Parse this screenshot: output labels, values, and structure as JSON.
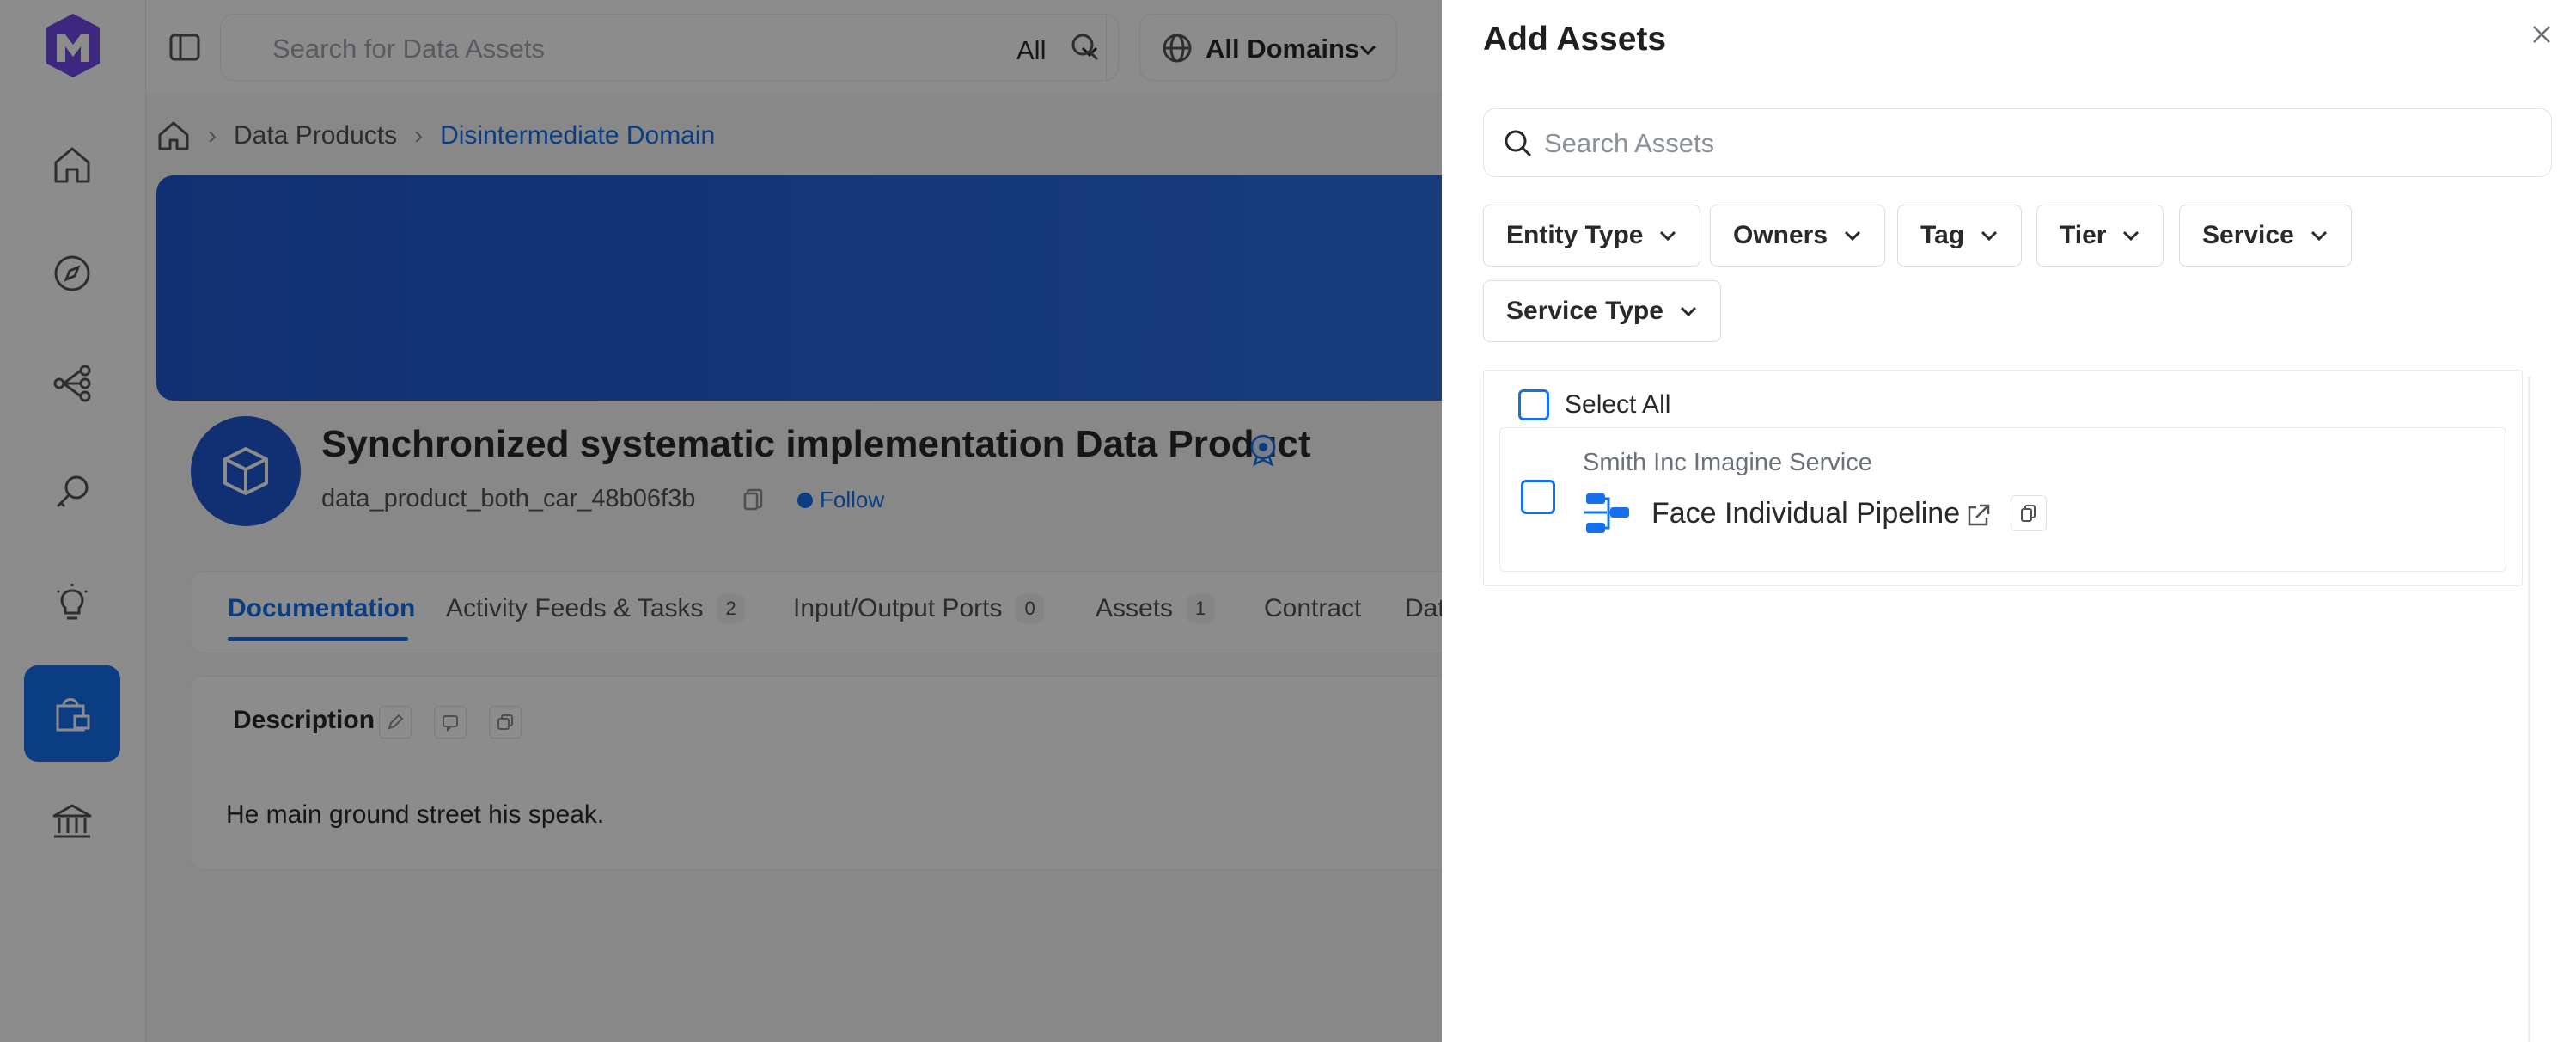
{
  "topbar": {
    "search_placeholder": "Search for Data Assets",
    "search_scope": "All",
    "domain_label": "All Domains"
  },
  "breadcrumb": {
    "items": [
      "Data Products",
      "Disintermediate Domain"
    ]
  },
  "data_product": {
    "title": "Synchronized systematic implementation Data Product",
    "fqn": "data_product_both_car_48b06f3b",
    "follow_label": "Follow"
  },
  "tabs": [
    {
      "label": "Documentation"
    },
    {
      "label": "Activity Feeds & Tasks",
      "count": "2"
    },
    {
      "label": "Input/Output Ports",
      "count": "0"
    },
    {
      "label": "Assets",
      "count": "1"
    },
    {
      "label": "Contract"
    },
    {
      "label": "Dat"
    }
  ],
  "description": {
    "title": "Description",
    "text": "He main ground street his speak."
  },
  "drawer": {
    "title": "Add Assets",
    "search_placeholder": "Search Assets",
    "filters": [
      "Entity Type",
      "Owners",
      "Tag",
      "Tier",
      "Service",
      "Service Type"
    ],
    "select_all_label": "Select All",
    "results": [
      {
        "service": "Smith Inc Imagine Service",
        "name": "Face Individual Pipeline",
        "icon": "pipeline-icon"
      }
    ]
  },
  "colors": {
    "accent": "#1470ef",
    "banner": "#1f58d1",
    "sidebar_active": "#1470ef"
  }
}
